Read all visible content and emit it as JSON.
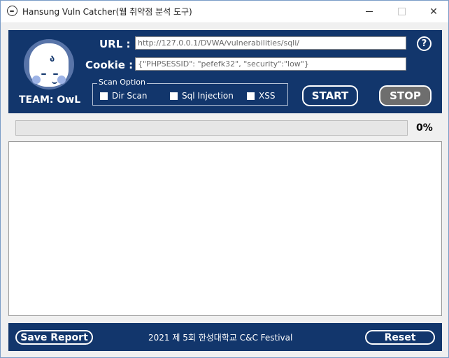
{
  "window": {
    "title": "Hansung Vuln Catcher(웹 취약점 분석 도구)",
    "min_glyph": "",
    "max_glyph": "",
    "close_glyph": "✕"
  },
  "header": {
    "team_label": "TEAM: OwL",
    "url_label": "URL :",
    "url_value": "http://127.0.0.1/DVWA/vulnerabilities/sqli/",
    "cookie_label": "Cookie :",
    "cookie_value": "{\"PHPSESSID\": \"pefefk32\", \"security\":\"low\"}",
    "help_glyph": "?",
    "logo_tuft": "ა"
  },
  "scan_option": {
    "legend": "Scan Option",
    "options": [
      {
        "label": "Dir Scan",
        "checked": false
      },
      {
        "label": "Sql Injection",
        "checked": false
      },
      {
        "label": "XSS",
        "checked": false
      }
    ]
  },
  "actions": {
    "start_label": "START",
    "stop_label": "STOP"
  },
  "progress": {
    "percent": 0,
    "text": "0%"
  },
  "footer": {
    "save_label": "Save Report",
    "center_text": "2021 제 5회 한성대학교 C&C Festival",
    "reset_label": "Reset"
  },
  "colors": {
    "panel": "#12366c",
    "stop_button": "#6e6e6e"
  }
}
